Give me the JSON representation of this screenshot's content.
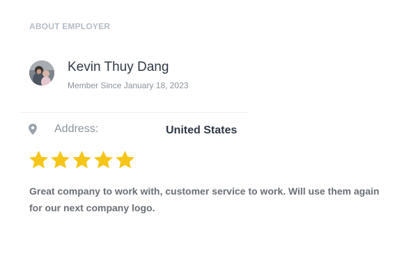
{
  "section": {
    "title": "ABOUT EMPLOYER"
  },
  "employer": {
    "name": "Kevin Thuy Dang",
    "member_since": "Member Since January 18, 2023",
    "avatar_icon": "profile-photo"
  },
  "address": {
    "icon": "map-pin-icon",
    "label": "Address:",
    "value": "United States"
  },
  "rating": {
    "value": 5,
    "max": 5,
    "star_color": "#f5c518"
  },
  "review": {
    "text": "Great company to work with, customer service to work. Will use them again for our next company logo."
  }
}
